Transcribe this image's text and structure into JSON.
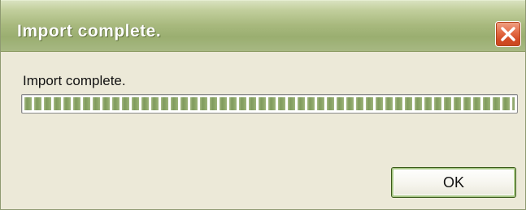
{
  "window": {
    "title": "Import complete."
  },
  "title_bar": {
    "close_icon": "close-icon"
  },
  "dialog": {
    "message": "Import complete.",
    "progress": {
      "value_percent": 100
    },
    "ok_label": "OK"
  },
  "colors": {
    "title_bar_green": "#a8b97e",
    "close_button_red": "#e36a44",
    "progress_green": "#8ba567",
    "dialog_background": "#ece9d8"
  }
}
